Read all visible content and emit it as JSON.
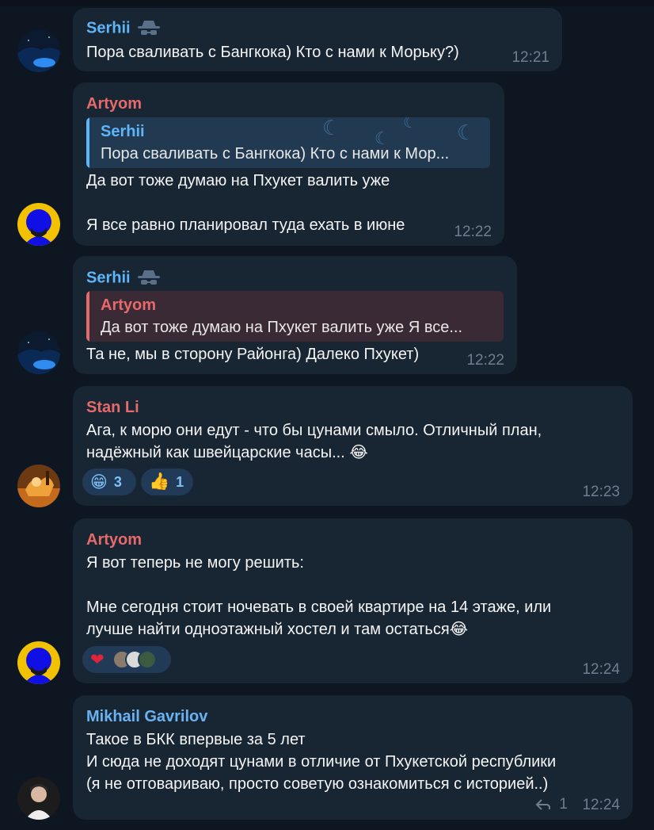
{
  "messages": [
    {
      "sender": "Serhii",
      "text": "Пора сваливать с Бангкока) Кто с нами к Морьку?)",
      "time": "12:21"
    },
    {
      "sender": "Artyom",
      "reply": {
        "name": "Serhii",
        "text": "Пора сваливать с Бангкока) Кто с нами к Мор..."
      },
      "line1": "Да вот тоже думаю на Пхукет валить уже",
      "line2": "Я все равно планировал туда ехать в июне",
      "time": "12:22"
    },
    {
      "sender": "Serhii",
      "reply": {
        "name": "Artyom",
        "text": "Да вот тоже думаю на Пхукет валить уже  Я все..."
      },
      "text": "Та не, мы в сторону Районга) Далеко Пхукет)",
      "time": "12:22"
    },
    {
      "sender": "Stan Li",
      "line1": "Ага, к морю они едут - что бы цунами смыло. Отличный план,",
      "line2": "надёжный как швейцарские часы...",
      "reactions": [
        {
          "emoji": "grinning-face",
          "glyph": "😁",
          "count": "3"
        },
        {
          "emoji": "thumbs-up",
          "glyph": "👍",
          "count": "1"
        }
      ],
      "time": "12:23"
    },
    {
      "sender": "Artyom",
      "line1": "Я вот теперь не могу решить:",
      "line2": "Мне сегодня стоит ночевать в своей квартире на 14 этаже, или",
      "line3": "лучше найти одноэтажный хостел и там остаться",
      "reaction_glyph": "❤",
      "time": "12:24"
    },
    {
      "sender": "Mikhail Gavrilov",
      "line1": "Такое в БКК впервые за 5 лет",
      "line2": "И сюда не доходят цунами в отличие от Пхукетской республики",
      "line3": "(я не отговариваю, просто советую ознакомиться с историей..)",
      "replies_count": "1",
      "time": "12:24"
    }
  ],
  "colors": {
    "background": "#0e1621",
    "bubble": "#182533",
    "serhii": "#5eb5f7",
    "artyom": "#e66a6a",
    "time": "#6d7f8f"
  }
}
